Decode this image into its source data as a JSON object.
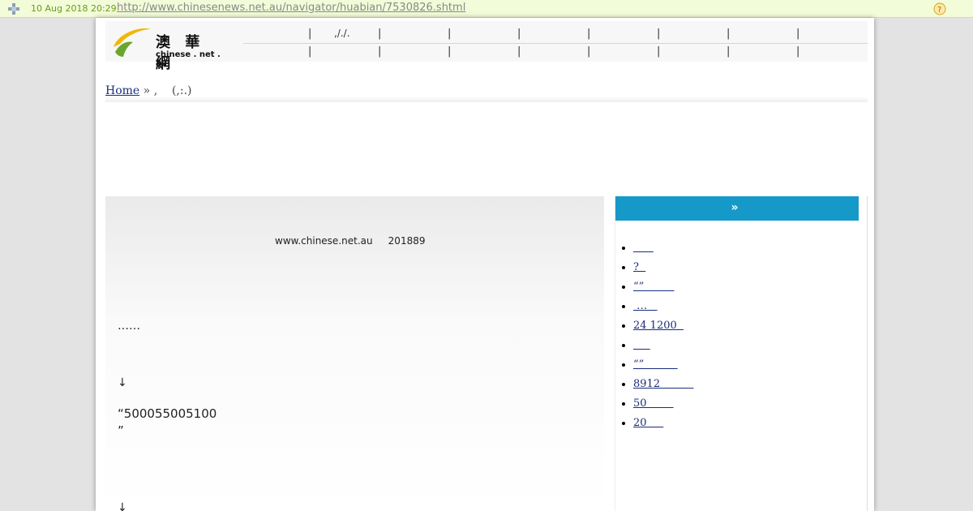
{
  "archive_bar": {
    "date": "10 Aug 2018 20:29",
    "url": "http://www.chinesenews.net.au/navigator/huabian/7530826.shtml",
    "logo_icon": "wayback-logo-icon",
    "help_icon": "help-icon"
  },
  "site": {
    "logo_cn": "澳 華 網",
    "logo_en": "chinese . net . au",
    "brand_colors": {
      "yellow": "#f2b705",
      "green": "#6aa62c"
    }
  },
  "nav": {
    "row1_items": [
      ",/./.",
      "",
      "",
      "",
      "",
      "",
      "",
      ""
    ],
    "row2_items": [
      "",
      "",
      "",
      "",
      "",
      "",
      "",
      ""
    ],
    "separator": "|"
  },
  "breadcrumb": {
    "home": "Home",
    "sep": "»",
    "current": ",    (,:.)"
  },
  "article": {
    "source_line": "www.chinese.net.au     201889",
    "para1": "……",
    "para2": "↓",
    "para3": "“500055005100",
    "para3b": "”",
    "para4": "↓"
  },
  "sidebar": {
    "title": "",
    "title_sep": "»",
    "accent_color": "#1599c8",
    "items": [
      "      ",
      "?  ",
      "“”         ",
      " …   ",
      "24 1200  ",
      "     ",
      "“”          ",
      "8912          ",
      "50        ",
      "20     "
    ]
  }
}
